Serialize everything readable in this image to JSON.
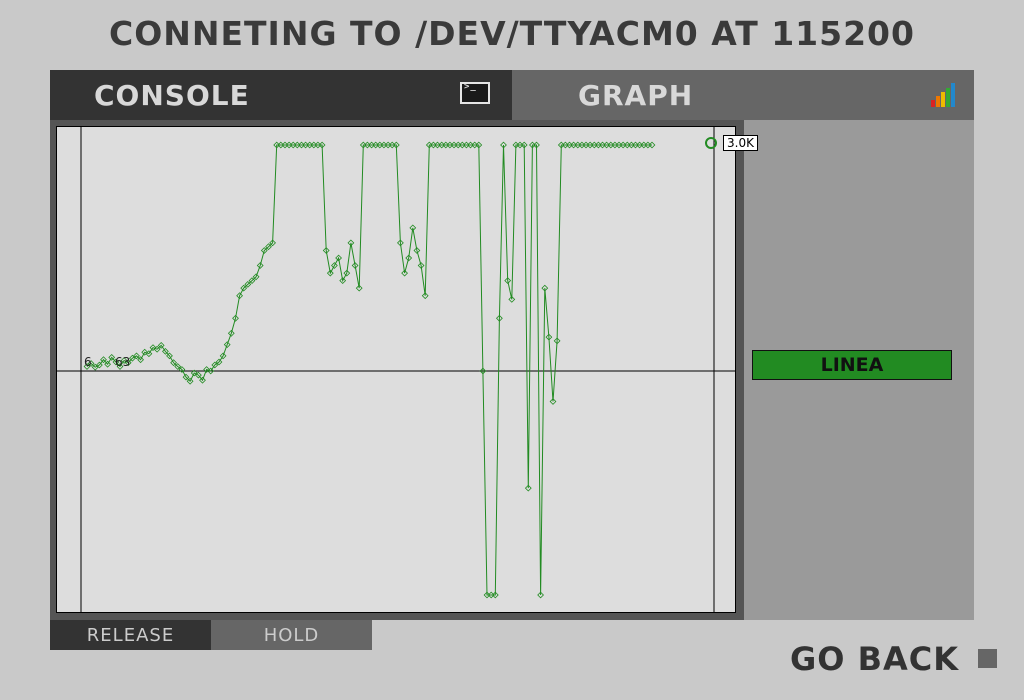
{
  "header": {
    "title": "CONNETING TO /DEV/TTYACM0 AT 115200"
  },
  "tabs": {
    "console_label": "CONSOLE",
    "graph_label": "GRAPH"
  },
  "buttons": {
    "linea_label": "LINEA",
    "release_label": "RELEASE",
    "hold_label": "HOLD",
    "go_back_label": "GO BACK"
  },
  "colors": {
    "line": "#228b22",
    "plot_bg": "#dddddd",
    "active_tab": "#333333",
    "inactive_tab": "#666666"
  },
  "chart_data": {
    "type": "line",
    "current_value_label": "3.0K",
    "baseline_label_left": "6",
    "baseline_label_right": "63",
    "ylim": [
      -1700,
      3000
    ],
    "series": [
      {
        "values": [
          60,
          100,
          50,
          80,
          150,
          90,
          180,
          120,
          60,
          140,
          110,
          170,
          200,
          150,
          250,
          230,
          310,
          290,
          340,
          260,
          200,
          110,
          60,
          20,
          -60,
          -100,
          -20,
          -40,
          -90,
          20,
          0,
          80,
          120,
          200,
          350,
          500,
          700,
          1000,
          1100,
          1150,
          1200,
          1250,
          1400,
          1600,
          1650,
          1700,
          3000,
          3000,
          3000,
          3000,
          3000,
          3000,
          3000,
          3000,
          3000,
          3000,
          3000,
          3000,
          1600,
          1300,
          1400,
          1500,
          1200,
          1300,
          1700,
          1400,
          1100,
          3000,
          3000,
          3000,
          3000,
          3000,
          3000,
          3000,
          3000,
          3000,
          1700,
          1300,
          1500,
          1900,
          1600,
          1400,
          1000,
          3000,
          3000,
          3000,
          3000,
          3000,
          3000,
          3000,
          3000,
          3000,
          3000,
          3000,
          3000,
          3000,
          0,
          -2200,
          -2200,
          -2200,
          700,
          3000,
          1200,
          950,
          3000,
          3000,
          3000,
          -1150,
          3000,
          3000,
          -2200,
          1100,
          450,
          -300,
          400,
          3000,
          3000,
          3000,
          3000,
          3000,
          3000,
          3000,
          3000,
          3000,
          3000,
          3000,
          3000,
          3000,
          3000,
          3000,
          3000,
          3000,
          3000,
          3000,
          3000,
          3000,
          3000,
          3000
        ]
      }
    ]
  }
}
